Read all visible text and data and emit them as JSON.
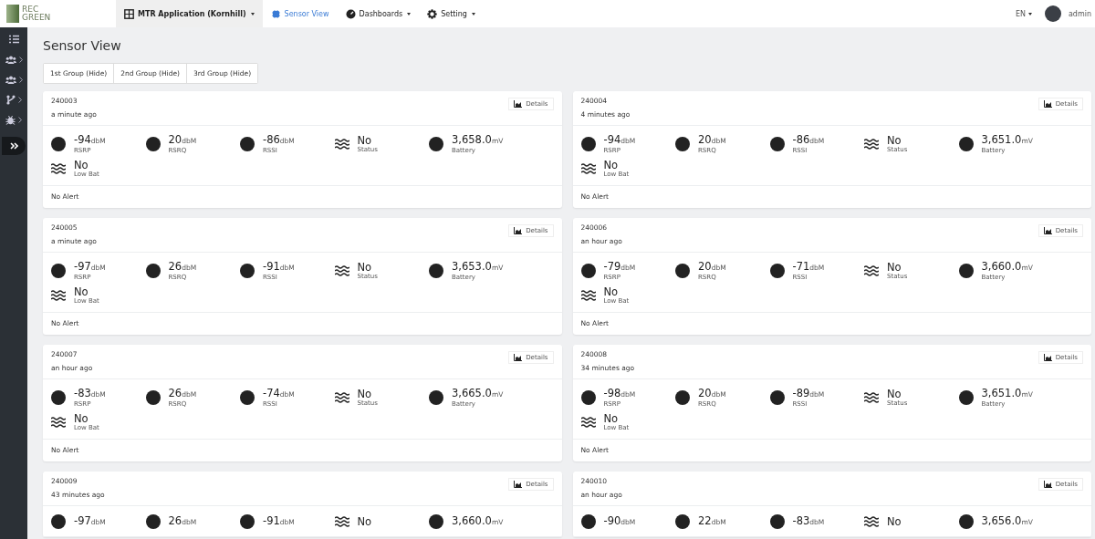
{
  "logo": {
    "line_1": "REC",
    "line_2": "GREEN"
  },
  "nav": [
    {
      "label": "MTR Application (Kornhill)",
      "dropdown": true,
      "kind": "app",
      "selected": false
    },
    {
      "label": "Sensor View",
      "dropdown": false,
      "kind": "link",
      "selected": true
    },
    {
      "label": "Dashboards",
      "dropdown": true,
      "kind": "link",
      "selected": false
    },
    {
      "label": "Setting",
      "dropdown": true,
      "kind": "link",
      "selected": false
    }
  ],
  "language": "EN",
  "user": "admin",
  "sidebar": [
    {
      "selected": false
    },
    {
      "selected": false
    },
    {
      "selected": false
    },
    {
      "selected": false
    },
    {
      "selected": false
    },
    {
      "selected": true
    }
  ],
  "title": "Sensor View",
  "groups": [
    "1st Group (Hide)",
    "2nd Group (Hide)",
    "3rd Group (Hide)"
  ],
  "cards": [
    {
      "id": "240003",
      "time": "a minute ago",
      "details": "Details",
      "metrics": [
        {
          "kind": "dot",
          "value": "-94",
          "unit": "dbM",
          "label": "RSRP"
        },
        {
          "kind": "dot",
          "value": "20",
          "unit": "dbM",
          "label": "RSRQ"
        },
        {
          "kind": "dot",
          "value": "-86",
          "unit": "dbM",
          "label": "RSSI"
        },
        {
          "kind": "wave",
          "value": "No",
          "label": "Status"
        },
        {
          "kind": "dot",
          "value": "3,658.0",
          "unit": "mV",
          "label": "Battery"
        },
        {
          "kind": "wave",
          "value": "No",
          "label": "Low Bat"
        }
      ],
      "alert": "No Alert"
    },
    {
      "id": "240004",
      "time": "4 minutes ago",
      "details": "Details",
      "metrics": [
        {
          "kind": "dot",
          "value": "-94",
          "unit": "dbM",
          "label": "RSRP"
        },
        {
          "kind": "dot",
          "value": "20",
          "unit": "dbM",
          "label": "RSRQ"
        },
        {
          "kind": "dot",
          "value": "-86",
          "unit": "dbM",
          "label": "RSSI"
        },
        {
          "kind": "wave",
          "value": "No",
          "label": "Status"
        },
        {
          "kind": "dot",
          "value": "3,651.0",
          "unit": "mV",
          "label": "Battery"
        },
        {
          "kind": "wave",
          "value": "No",
          "label": "Low Bat"
        }
      ],
      "alert": "No Alert"
    },
    {
      "id": "240005",
      "time": "a minute ago",
      "details": "Details",
      "metrics": [
        {
          "kind": "dot",
          "value": "-97",
          "unit": "dbM",
          "label": "RSRP"
        },
        {
          "kind": "dot",
          "value": "26",
          "unit": "dbM",
          "label": "RSRQ"
        },
        {
          "kind": "dot",
          "value": "-91",
          "unit": "dbM",
          "label": "RSSI"
        },
        {
          "kind": "wave",
          "value": "No",
          "label": "Status"
        },
        {
          "kind": "dot",
          "value": "3,653.0",
          "unit": "mV",
          "label": "Battery"
        },
        {
          "kind": "wave",
          "value": "No",
          "label": "Low Bat"
        }
      ],
      "alert": "No Alert"
    },
    {
      "id": "240006",
      "time": "an hour ago",
      "details": "Details",
      "metrics": [
        {
          "kind": "dot",
          "value": "-79",
          "unit": "dbM",
          "label": "RSRP"
        },
        {
          "kind": "dot",
          "value": "20",
          "unit": "dbM",
          "label": "RSRQ"
        },
        {
          "kind": "dot",
          "value": "-71",
          "unit": "dbM",
          "label": "RSSI"
        },
        {
          "kind": "wave",
          "value": "No",
          "label": "Status"
        },
        {
          "kind": "dot",
          "value": "3,660.0",
          "unit": "mV",
          "label": "Battery"
        },
        {
          "kind": "wave",
          "value": "No",
          "label": "Low Bat"
        }
      ],
      "alert": "No Alert"
    },
    {
      "id": "240007",
      "time": "an hour ago",
      "details": "Details",
      "metrics": [
        {
          "kind": "dot",
          "value": "-83",
          "unit": "dbM",
          "label": "RSRP"
        },
        {
          "kind": "dot",
          "value": "26",
          "unit": "dbM",
          "label": "RSRQ"
        },
        {
          "kind": "dot",
          "value": "-74",
          "unit": "dbM",
          "label": "RSSI"
        },
        {
          "kind": "wave",
          "value": "No",
          "label": "Status"
        },
        {
          "kind": "dot",
          "value": "3,665.0",
          "unit": "mV",
          "label": "Battery"
        },
        {
          "kind": "wave",
          "value": "No",
          "label": "Low Bat"
        }
      ],
      "alert": "No Alert"
    },
    {
      "id": "240008",
      "time": "34 minutes ago",
      "details": "Details",
      "metrics": [
        {
          "kind": "dot",
          "value": "-98",
          "unit": "dbM",
          "label": "RSRP"
        },
        {
          "kind": "dot",
          "value": "20",
          "unit": "dbM",
          "label": "RSRQ"
        },
        {
          "kind": "dot",
          "value": "-89",
          "unit": "dbM",
          "label": "RSSI"
        },
        {
          "kind": "wave",
          "value": "No",
          "label": "Status"
        },
        {
          "kind": "dot",
          "value": "3,651.0",
          "unit": "mV",
          "label": "Battery"
        },
        {
          "kind": "wave",
          "value": "No",
          "label": "Low Bat"
        }
      ],
      "alert": "No Alert"
    },
    {
      "id": "240009",
      "time": "43 minutes ago",
      "details": "Details",
      "metrics": [
        {
          "kind": "dot",
          "value": "-97",
          "unit": "dbM"
        },
        {
          "kind": "dot",
          "value": "26",
          "unit": "dbM"
        },
        {
          "kind": "dot",
          "value": "-91",
          "unit": "dbM"
        },
        {
          "kind": "wave",
          "value": "No"
        },
        {
          "kind": "dot",
          "value": "3,660.0",
          "unit": "mV"
        }
      ]
    },
    {
      "id": "240010",
      "time": "an hour ago",
      "details": "Details",
      "metrics": [
        {
          "kind": "dot",
          "value": "-90",
          "unit": "dbM"
        },
        {
          "kind": "dot",
          "value": "22",
          "unit": "dbM"
        },
        {
          "kind": "dot",
          "value": "-83",
          "unit": "dbM"
        },
        {
          "kind": "wave",
          "value": "No"
        },
        {
          "kind": "dot",
          "value": "3,656.0",
          "unit": "mV"
        }
      ]
    }
  ]
}
